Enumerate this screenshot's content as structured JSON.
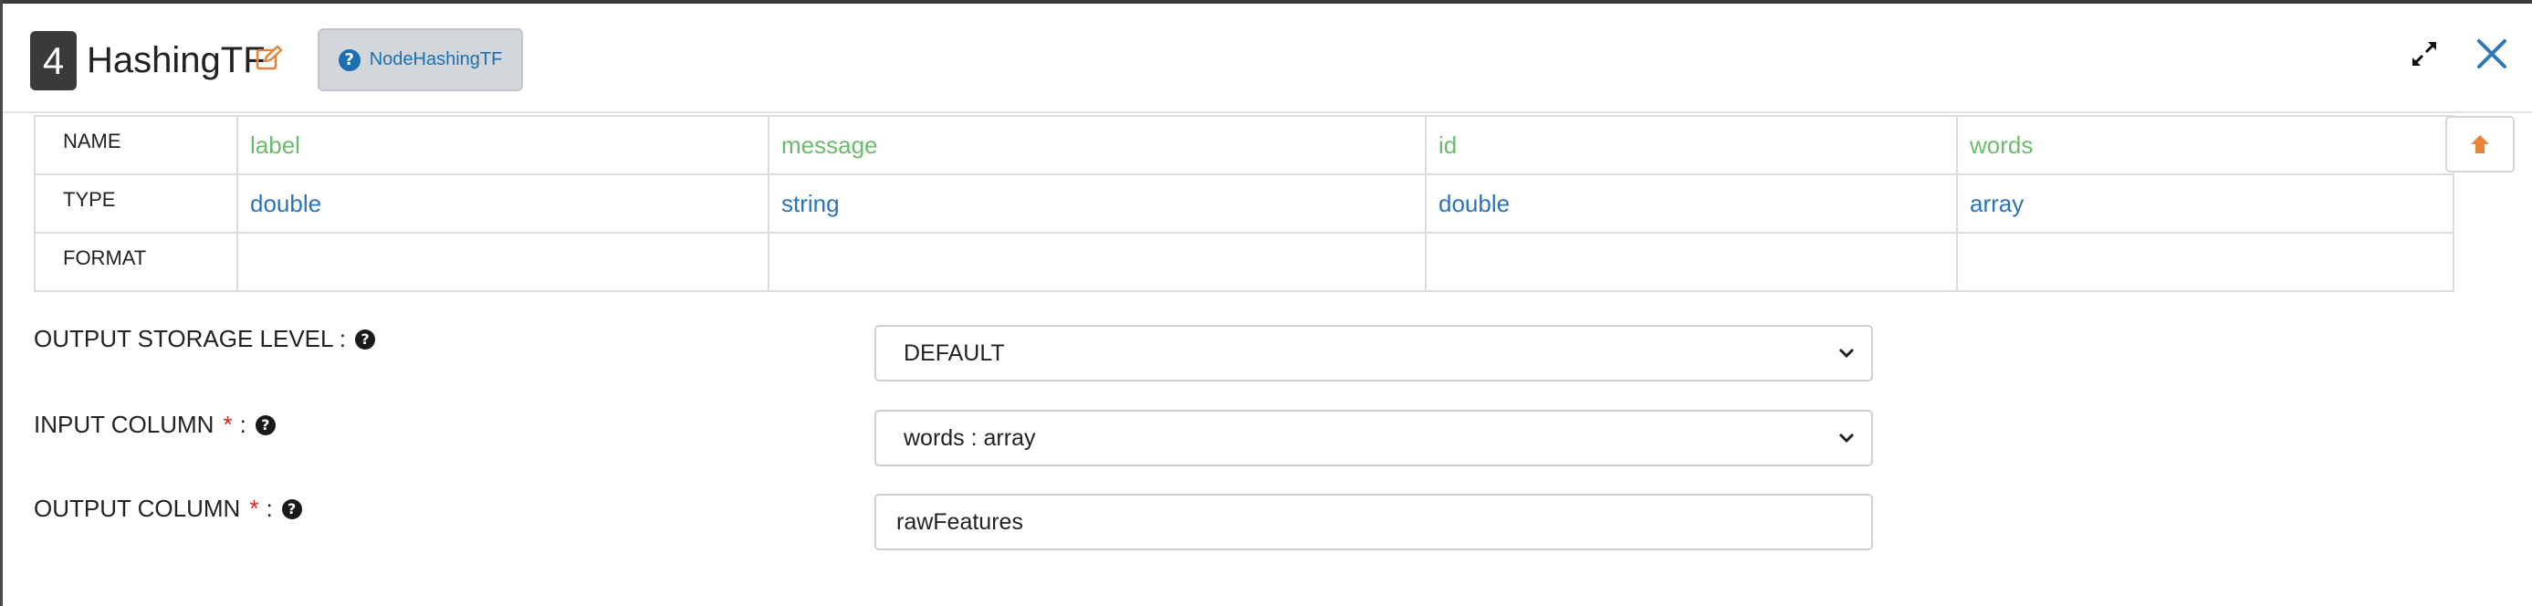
{
  "header": {
    "step_number": "4",
    "title": "HashingTF",
    "node_button_label": "NodeHashingTF"
  },
  "schema_table": {
    "row_headers": [
      "NAME",
      "TYPE",
      "FORMAT"
    ],
    "columns": [
      {
        "name": "label",
        "type": "double",
        "format": ""
      },
      {
        "name": "message",
        "type": "string",
        "format": ""
      },
      {
        "name": "id",
        "type": "double",
        "format": ""
      },
      {
        "name": "words",
        "type": "array",
        "format": ""
      }
    ]
  },
  "form": {
    "output_storage_level": {
      "label": "OUTPUT STORAGE LEVEL :",
      "value": "DEFAULT"
    },
    "input_column": {
      "label": "INPUT COLUMN",
      "required_mark": "*",
      "suffix": ":",
      "value": "words : array"
    },
    "output_column": {
      "label": "OUTPUT COLUMN",
      "required_mark": "*",
      "suffix": ":",
      "value": "rawFeatures"
    }
  },
  "icons": {
    "edit": "edit-icon",
    "help": "question-circle-icon",
    "expand": "expand-icon",
    "close": "close-icon",
    "scroll_up": "arrow-up-icon",
    "dropdown": "chevron-down-icon"
  },
  "colors": {
    "accent_blue": "#1e6fb0",
    "name_green": "#6cba6c",
    "type_blue": "#2a73b8",
    "edit_orange": "#e8833a",
    "required_red": "#e02020"
  }
}
